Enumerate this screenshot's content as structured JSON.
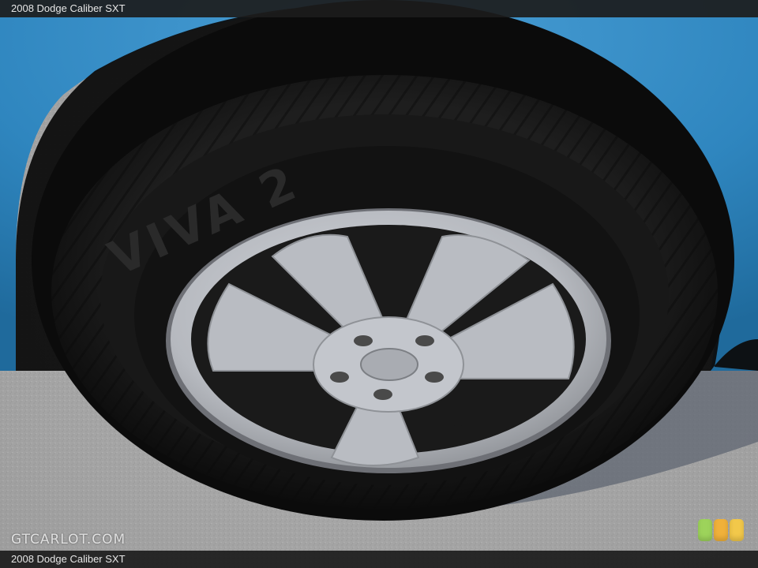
{
  "photo": {
    "title": "2008 Dodge Caliber SXT",
    "caption": "2008 Dodge Caliber SXT",
    "tire_brand": "VIVA 2",
    "watermark": "GTCARLOT.COM",
    "colors": {
      "body_paint": "#2f86bf",
      "tire": "#141414",
      "wheel": "#b9bcc2",
      "pavement": "#a9a9a9"
    },
    "rating_colors": [
      "#9dd35b",
      "#f0b13a",
      "#f2c84a"
    ]
  }
}
